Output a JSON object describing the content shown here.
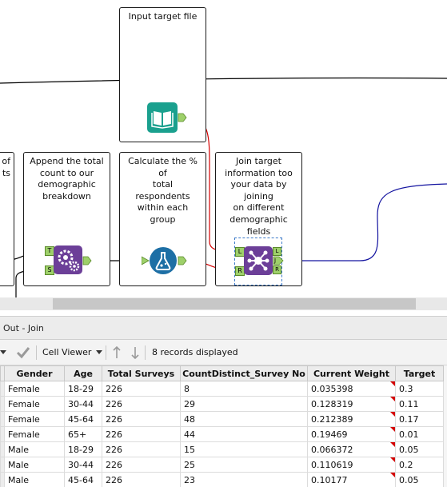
{
  "canvas": {
    "containers": {
      "input": "Input target file",
      "partial": "of\nts",
      "append": "Append the total\ncount to our\ndemographic\nbreakdown",
      "calc": "Calculate the % of\ntotal respondents\nwithin each group",
      "join": "Join target\ninformation too\nyour data by joining\non different\ndemographic fields"
    },
    "anchors": {
      "t": "T",
      "s": "S",
      "l": "L",
      "r": "R",
      "j": "J"
    },
    "colors": {
      "wire": "#000000",
      "wire_left": "#d40000",
      "wire_right": "#1414a0",
      "input_tool": "#1aa08e",
      "append_tool": "#6c3f98",
      "formula_tool": "#1d6fa5",
      "join_tool": "#6c3f98",
      "anchor": "#9ed06a"
    },
    "icons": {
      "input": "book-icon",
      "append": "gears-icon",
      "formula": "flask-icon",
      "join": "join-network-icon"
    }
  },
  "results": {
    "panel_title": "Out - Join",
    "toolbar": {
      "cell_viewer": "Cell Viewer",
      "records": "8 records displayed"
    },
    "columns": [
      "Gender",
      "Age",
      "Total Surveys",
      "CountDistinct_Survey No",
      "Current Weight",
      "Target"
    ],
    "rows": [
      [
        "Female",
        "18-29",
        "226",
        "8",
        "0.035398",
        "0.3"
      ],
      [
        "Female",
        "30-44",
        "226",
        "29",
        "0.128319",
        "0.11"
      ],
      [
        "Female",
        "45-64",
        "226",
        "48",
        "0.212389",
        "0.17"
      ],
      [
        "Female",
        "65+",
        "226",
        "44",
        "0.19469",
        "0.01"
      ],
      [
        "Male",
        "18-29",
        "226",
        "15",
        "0.066372",
        "0.05"
      ],
      [
        "Male",
        "30-44",
        "226",
        "25",
        "0.110619",
        "0.2"
      ],
      [
        "Male",
        "45-64",
        "226",
        "23",
        "0.10177",
        "0.05"
      ]
    ]
  }
}
